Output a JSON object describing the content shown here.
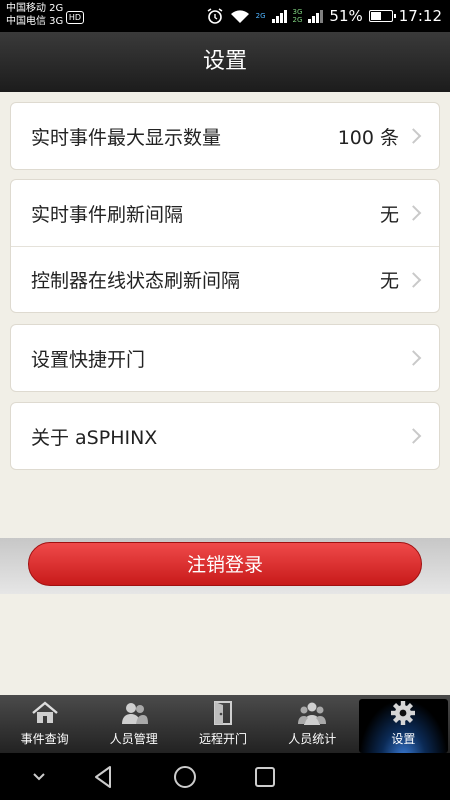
{
  "status_bar": {
    "carrier1": "中国移动 2G",
    "carrier2": "中国电信 3G",
    "hd_badge": "HD",
    "net_a": [
      "2G"
    ],
    "net_b": [
      "3G",
      "2G"
    ],
    "battery_text": "51%",
    "battery_level": 0.51,
    "time": "17:12"
  },
  "header": {
    "title": "设置"
  },
  "settings": {
    "groups": [
      {
        "rows": [
          {
            "label": "实时事件最大显示数量",
            "value": "100 条"
          }
        ]
      },
      {
        "rows": [
          {
            "label": "实时事件刷新间隔",
            "value": "无"
          },
          {
            "label": "控制器在线状态刷新间隔",
            "value": "无"
          }
        ]
      },
      {
        "rows": [
          {
            "label": "设置快捷开门",
            "value": ""
          }
        ]
      },
      {
        "rows": [
          {
            "label": "关于 aSPHINX",
            "value": ""
          }
        ]
      }
    ]
  },
  "logout": {
    "label": "注销登录"
  },
  "tabs": [
    {
      "label": "事件查询",
      "icon": "home-icon"
    },
    {
      "label": "人员管理",
      "icon": "people-icon"
    },
    {
      "label": "远程开门",
      "icon": "door-icon"
    },
    {
      "label": "人员统计",
      "icon": "group-icon"
    },
    {
      "label": "设置",
      "icon": "gear-icon",
      "active": true
    }
  ],
  "colors": {
    "accent_red": "#dd3333",
    "active_tab_glow": "#3a7bd5"
  }
}
